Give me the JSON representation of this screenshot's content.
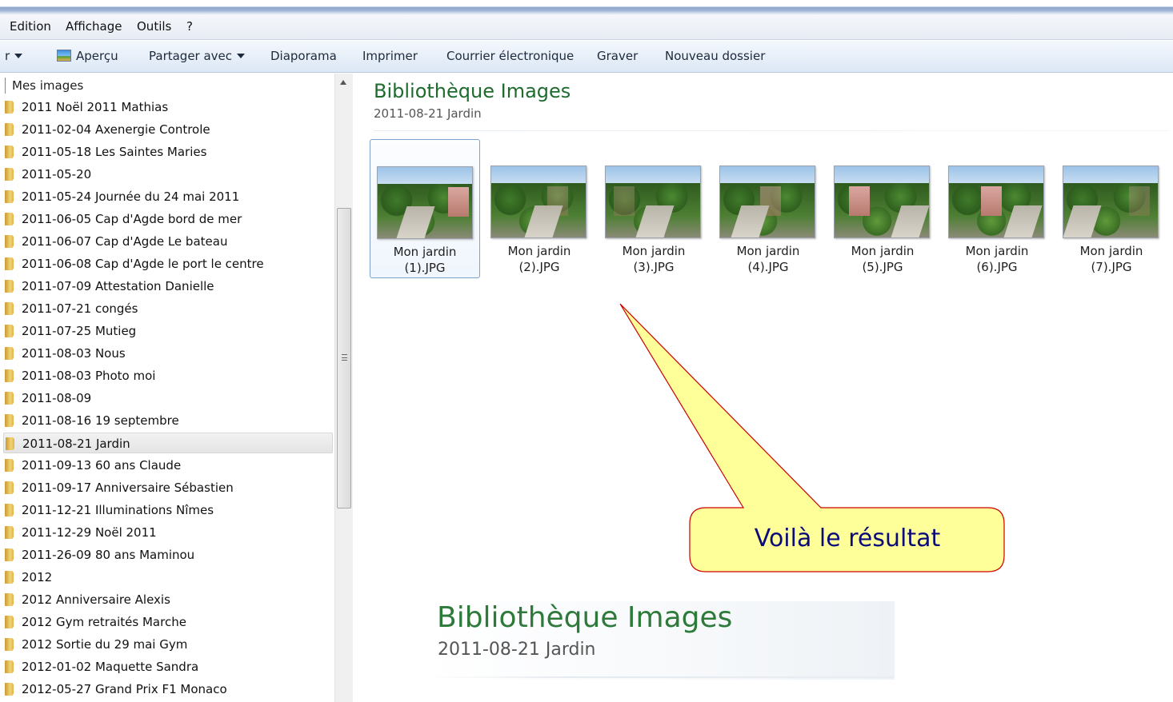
{
  "menu": {
    "items": [
      "Edition",
      "Affichage",
      "Outils",
      "?"
    ]
  },
  "toolbar": {
    "organize_fragment": "r",
    "preview": "Aperçu",
    "share": "Partager avec",
    "slideshow": "Diaporama",
    "print": "Imprimer",
    "email": "Courrier électronique",
    "burn": "Graver",
    "new_folder": "Nouveau dossier"
  },
  "nav": {
    "root": "Mes images",
    "items": [
      "2011 Noël 2011 Mathias",
      "2011-02-04 Axenergie Controle",
      "2011-05-18 Les Saintes Maries",
      "2011-05-20",
      "2011-05-24 Journée du 24 mai 2011",
      "2011-06-05 Cap d'Agde bord de mer",
      "2011-06-07 Cap d'Agde Le bateau",
      "2011-06-08 Cap d'Agde le port le centre",
      "2011-07-09 Attestation Danielle",
      "2011-07-21 congés",
      "2011-07-25 Mutieg",
      "2011-08-03 Nous",
      "2011-08-03 Photo moi",
      "2011-08-09",
      "2011-08-16 19 septembre",
      "2011-08-21 Jardin",
      "2011-09-13 60 ans Claude",
      "2011-09-17 Anniversaire Sébastien",
      "2011-12-21 Illuminations Nîmes",
      "2011-12-29 Noël 2011",
      "2011-26-09 80 ans Maminou",
      "2012",
      "2012 Anniversaire Alexis",
      "2012 Gym retraités Marche",
      "2012 Sortie du 29 mai Gym",
      "2012-01-02 Maquette Sandra",
      "2012-05-27 Grand Prix F1 Monaco"
    ],
    "selected_index": 15
  },
  "library": {
    "title": "Bibliothèque Images",
    "subtitle": "2011-08-21 Jardin"
  },
  "thumbnails": [
    {
      "line1": "Mon jardin",
      "line2": "(1).JPG"
    },
    {
      "line1": "Mon jardin",
      "line2": "(2).JPG"
    },
    {
      "line1": "Mon jardin",
      "line2": "(3).JPG"
    },
    {
      "line1": "Mon jardin",
      "line2": "(4).JPG"
    },
    {
      "line1": "Mon jardin",
      "line2": "(5).JPG"
    },
    {
      "line1": "Mon jardin",
      "line2": "(6).JPG"
    },
    {
      "line1": "Mon jardin",
      "line2": "(7).JPG"
    }
  ],
  "callout": {
    "text": "Voilà le résultat",
    "fill": "#ffff99",
    "stroke": "#cc0000"
  },
  "zoom": {
    "title": "Bibliothèque Images",
    "subtitle": "2011-08-21 Jardin"
  }
}
